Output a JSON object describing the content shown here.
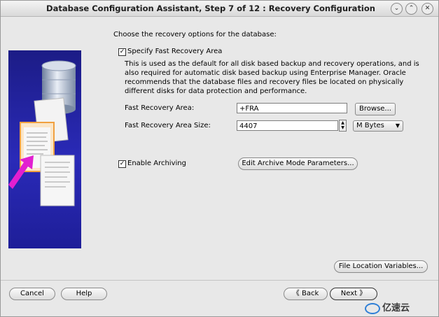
{
  "window": {
    "title": "Database Configuration Assistant, Step 7 of 12 : Recovery Configuration",
    "controls": [
      "chevron-down",
      "chevron-up",
      "close"
    ]
  },
  "main": {
    "intro": "Choose the recovery options for the database:",
    "fast_recovery": {
      "checkbox_label": "Specify Fast Recovery Area",
      "checked": true,
      "description": "This is used as the default for all disk based backup and recovery operations, and is also required for automatic disk based backup using Enterprise Manager. Oracle recommends that the database files and recovery files be located on physically different disks for data protection and performance.",
      "area_label": "Fast Recovery Area:",
      "area_value": "+FRA",
      "browse_label": "Browse...",
      "size_label": "Fast Recovery Area Size:",
      "size_value": "4407",
      "unit_value": "M Bytes"
    },
    "archiving": {
      "checkbox_label": "Enable Archiving",
      "checked": true,
      "edit_label": "Edit Archive Mode Parameters..."
    },
    "file_location_label": "File Location Variables..."
  },
  "footer": {
    "cancel_label": "Cancel",
    "help_label": "Help",
    "back_label": "Back",
    "next_label": "Next"
  },
  "watermark": {
    "text": "亿速云"
  }
}
